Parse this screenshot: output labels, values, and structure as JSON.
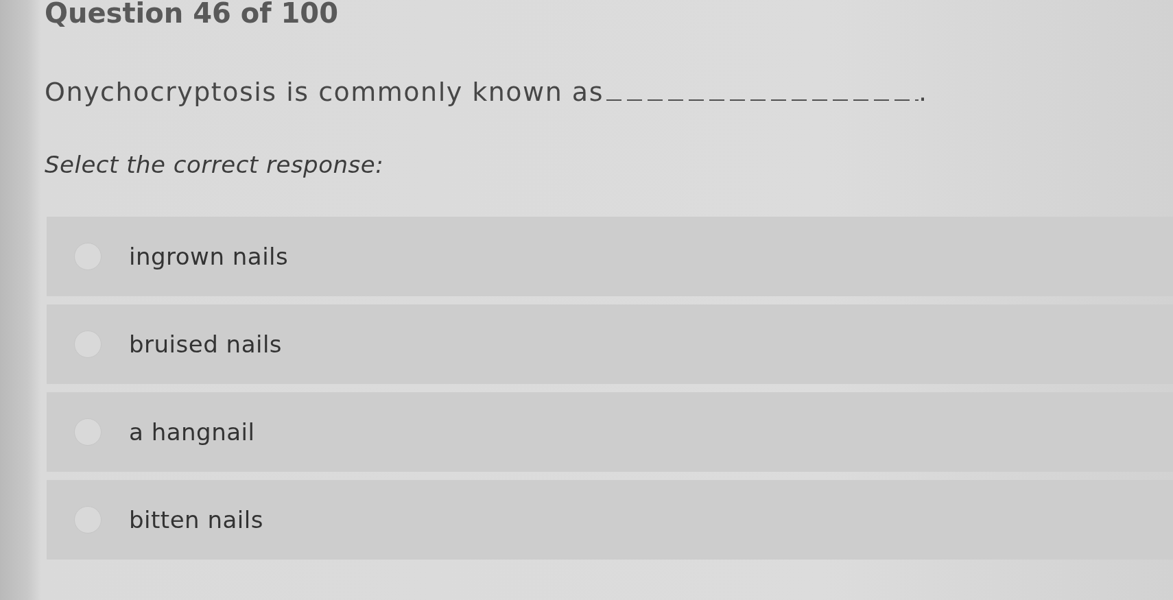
{
  "header": {
    "title": "Question 46 of 100"
  },
  "question": {
    "parts": [
      {
        "kind": "text",
        "text": "Onychocryptosis is commonly known as"
      },
      {
        "kind": "blank"
      },
      {
        "kind": "text",
        "text": "."
      }
    ]
  },
  "instruction": "Select the correct response:",
  "options": [
    {
      "label": "ingrown nails",
      "selected": false
    },
    {
      "label": "bruised nails",
      "selected": false
    },
    {
      "label": "a hangnail",
      "selected": false
    },
    {
      "label": "bitten nails",
      "selected": false
    }
  ]
}
